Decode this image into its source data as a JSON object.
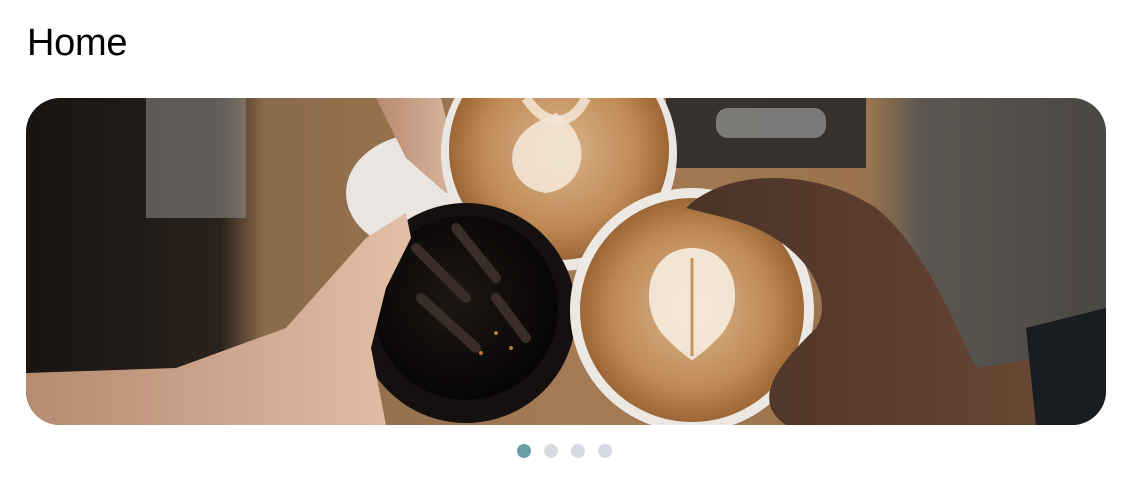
{
  "header": {
    "title": "Home"
  },
  "carousel": {
    "slide_count": 4,
    "active_index": 0,
    "active_slide_subject": "coffee-toast-photo"
  },
  "colors": {
    "dot_active": "#6a9ea6",
    "dot_inactive": "#d7dbe1"
  }
}
